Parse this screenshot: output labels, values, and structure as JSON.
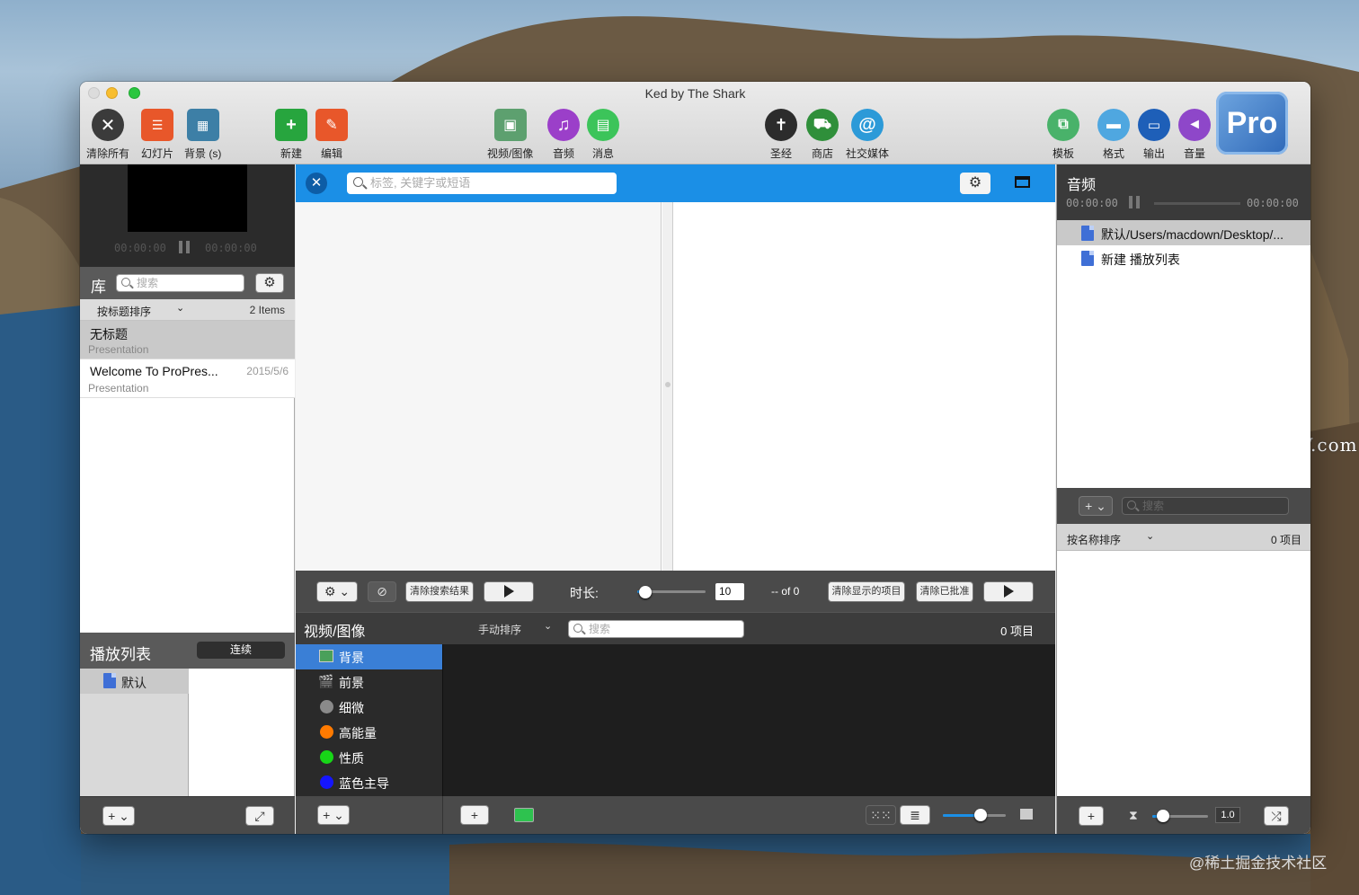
{
  "window": {
    "title": "Ked by The Shark"
  },
  "toolbar": {
    "clear_all": "清除所有",
    "slides": "幻灯片",
    "background": "背景 (s)",
    "new": "新建",
    "edit": "编辑",
    "video_image": "视频/图像",
    "audio": "音频",
    "message": "消息",
    "bible": "圣经",
    "store": "商店",
    "social": "社交媒体",
    "template": "模板",
    "format": "格式",
    "output": "输出",
    "volume": "音量",
    "logo": "Pro"
  },
  "preview": {
    "time_left": "00:00:00",
    "time_right": "00:00:00"
  },
  "library": {
    "label": "库",
    "search_placeholder": "搜索",
    "sort_label": "按标题排序",
    "count": "2 Items",
    "items": [
      {
        "title": "无标题",
        "subtitle": "Presentation",
        "date": ""
      },
      {
        "title": "Welcome To ProPres...",
        "subtitle": "Presentation",
        "date": "2015/5/6"
      }
    ]
  },
  "playlist": {
    "label": "播放列表",
    "mode": "连续",
    "items": [
      {
        "label": "默认"
      }
    ]
  },
  "editor": {
    "search_placeholder": "标签, 关键字或短语",
    "clear_search": "清除搜索结果",
    "duration_label": "时长:",
    "duration_value": "10",
    "duration_fraction": 0.12,
    "pager": "-- of 0",
    "clear_shown": "清除显示的项目",
    "clear_approved": "清除已批准"
  },
  "media": {
    "title": "视频/图像",
    "sort_label": "手动排序",
    "search_placeholder": "搜索",
    "count": "0 项目",
    "zoom_fraction": 0.6,
    "categories": [
      {
        "label": "背景",
        "icon": "image-icon",
        "color": ""
      },
      {
        "label": "前景",
        "icon": "clapper-icon",
        "color": ""
      },
      {
        "label": "细微",
        "icon": "dot",
        "color": "#8a8a8a"
      },
      {
        "label": "高能量",
        "icon": "dot",
        "color": "#ff7a00"
      },
      {
        "label": "性质",
        "icon": "dot",
        "color": "#17d617"
      },
      {
        "label": "蓝色主导",
        "icon": "dot",
        "color": "#1515ff"
      }
    ]
  },
  "audio": {
    "title": "音频",
    "time_left": "00:00:00",
    "time_right": "00:00:00",
    "items": [
      {
        "label": "默认/Users/macdown/Desktop/..."
      },
      {
        "label": "新建 播放列表"
      }
    ],
    "search_placeholder": "搜索",
    "sort_label": "按名称排序",
    "count": "0 项目",
    "volume_value": "1.0",
    "volume_fraction": 0.2
  },
  "watermarks": {
    "macw": "www.MacW.com",
    "juejin": "@稀土掘金技术社区"
  },
  "colors": {
    "accent": "#1b8fe6",
    "dark_panel": "#4a4a4a"
  }
}
